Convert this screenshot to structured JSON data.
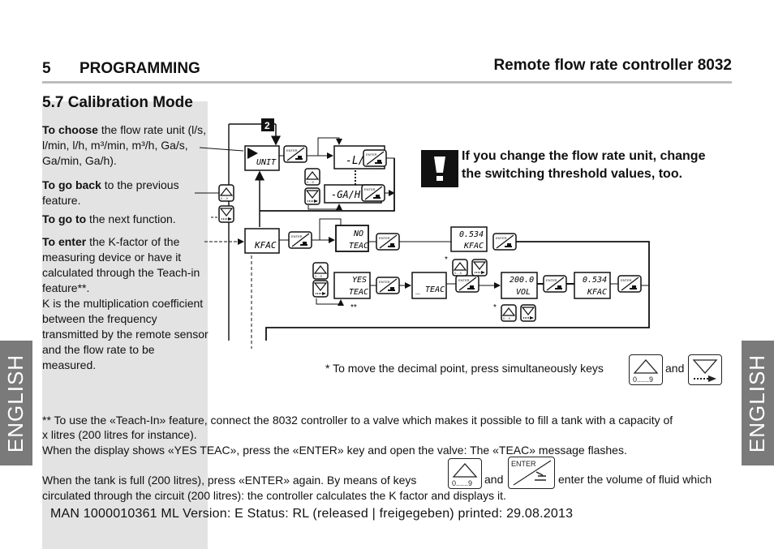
{
  "header": {
    "chapter_number": "5",
    "chapter_title": "PROGRAMMING",
    "product_title": "Remote flow rate controller 8032"
  },
  "section": {
    "title": "5.7  Calibration Mode"
  },
  "side_tabs": {
    "left": "ENGLISH",
    "right": "ENGLISH"
  },
  "labels": {
    "choose_bold": "To choose",
    "choose_rest": " the flow rate unit (l/s, l/min, l/h, m³/min, m³/h, Ga/s, Ga/min, Ga/h).",
    "back_bold": "To go back",
    "back_rest": " to the previous feature.",
    "goto_bold": "To go to",
    "goto_rest": " the next function.",
    "enter_bold": "To enter",
    "enter_rest": " the K-factor of the measuring device or have it calculated through the Teach-in feature**.",
    "k_definition": "K is the multiplication coefficient between the frequency transmitted by the remote sensor and the flow rate to be measured."
  },
  "warning": {
    "icon": "exclamation-icon",
    "text": "If you change the flow rate unit, change the switching threshold values, too."
  },
  "diagram": {
    "step_badge": "2",
    "displays": {
      "unit": "UNIT",
      "ls": "-L/S",
      "gah": "-GA/H",
      "kfac": "KFAC",
      "no_teac": [
        "NO",
        "TEAC"
      ],
      "yes_teac": [
        "YES",
        "TEAC"
      ],
      "teac": "_ TEAC",
      "kfac_value": [
        "0.534",
        "KFAC"
      ],
      "vol": [
        "200.0",
        "VOL"
      ],
      "kfac_result": [
        "0.534",
        "KFAC"
      ]
    },
    "enter_key_label": "ENTER",
    "up_key_label": "0.....9",
    "star": "*",
    "double_star": "**"
  },
  "footnotes": {
    "decimal_point": "* To move the decimal point, press simultaneously keys",
    "and": "and",
    "teach_in_1": "** To use the «Teach-In» feature, connect the 8032 controller to a valve which makes it possible to fill a tank with a capacity of",
    "teach_in_2": "x litres (200 litres for instance).",
    "teach_in_3": "When the display shows «YES TEAC», press the «ENTER» key and open the valve: The «TEAC» message flashes.",
    "teach_in_4a": "When the tank is full (200 litres), press «ENTER» again. By means of keys",
    "teach_in_4b": "and",
    "teach_in_4c": "enter the volume of fluid which",
    "teach_in_5": "circulated through the circuit (200 litres): the controller calculates the K factor and displays it.",
    "key_up_label": "0......9",
    "key_enter_label": "ENTER"
  },
  "document_footer": "MAN  1000010361  ML  Version: E Status: RL (released | freigegeben)  printed: 29.08.2013"
}
